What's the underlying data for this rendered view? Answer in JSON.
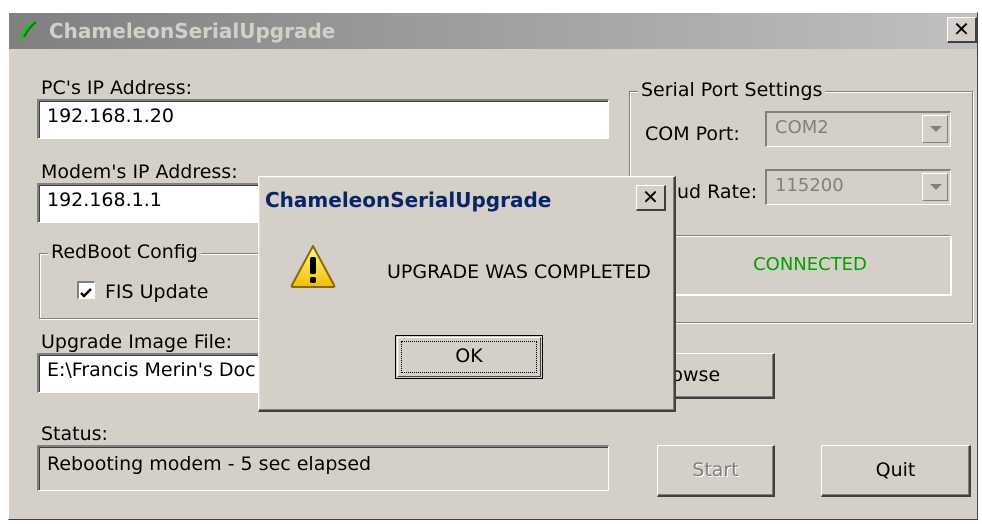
{
  "app": {
    "title": "ChameleonSerialUpgrade",
    "close_glyph": "✕"
  },
  "main": {
    "pc_ip_label": "PC's IP Address:",
    "pc_ip_value": "192.168.1.20",
    "modem_ip_label": "Modem's IP Address:",
    "modem_ip_value": "192.168.1.1",
    "redboot_legend": "RedBoot Config",
    "fis_update_label": "FIS Update",
    "fis_update_checked": true,
    "upgrade_file_label": "Upgrade Image File:",
    "upgrade_file_value": "E:\\Francis Merin's Doc",
    "browse_label": "rowse",
    "status_label": "Status:",
    "status_value": "Rebooting modem - 5 sec elapsed",
    "start_label": "Start",
    "quit_label": "Quit"
  },
  "serial": {
    "legend": "Serial Port Settings",
    "com_label": "COM Port:",
    "com_value": "COM2",
    "baud_label": "ud Rate:",
    "baud_value": "115200",
    "connection_status": "CONNECTED",
    "connection_color": "#00a000"
  },
  "dialog": {
    "title": "ChameleonSerialUpgrade",
    "message": "UPGRADE WAS COMPLETED",
    "ok_label": "OK",
    "icon": "warning-icon"
  }
}
